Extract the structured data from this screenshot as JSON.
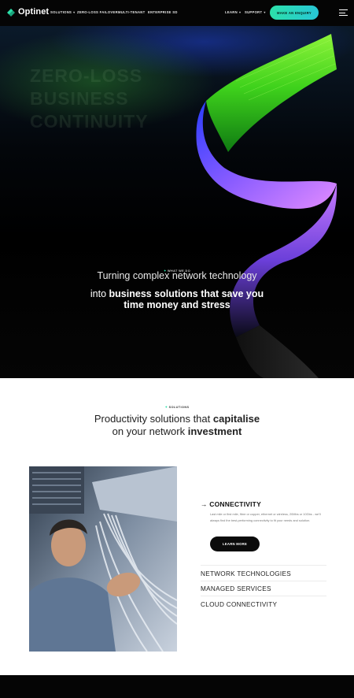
{
  "brand": {
    "name": "Optinet",
    "accent": "#2ce0a9"
  },
  "nav": {
    "items": [
      "SOLUTIONS",
      "ZERO-LOSS FAILOVER",
      "MULTI-TENANT",
      "ENTERPRISE SD"
    ],
    "right_items": [
      "LEARN",
      "SUPPORT"
    ],
    "cta": "MAKE AN ENQUIRY",
    "menu_icon": "hamburger-icon"
  },
  "hero": {
    "ghost_lines": [
      "ZERO-LOSS",
      "BUSINESS",
      "CONTINUITY"
    ],
    "eyebrow": "WHAT WE DO",
    "line1": "Turning complex network technology",
    "line2_plain": "into ",
    "line2_bold": "business solutions that save you",
    "line3": "time money and stress"
  },
  "solutions": {
    "eyebrow": "SOLUTIONS",
    "heading_plain_1": "Productivity solutions that ",
    "heading_bold_1": "capitalise",
    "heading_plain_2": "on your network ",
    "heading_bold_2": "investment",
    "active": {
      "title": "CONNECTIVITY",
      "description": "Last mile or first mile, fibre or copper, ethernet or wireless, 20Mbs or 10Gbs - we'll always find the best-performing connectivity to fit your needs and solution.",
      "button": "LEARN MORE"
    },
    "items": [
      "NETWORK TECHNOLOGIES",
      "MANAGED SERVICES",
      "CLOUD CONNECTIVITY"
    ]
  }
}
